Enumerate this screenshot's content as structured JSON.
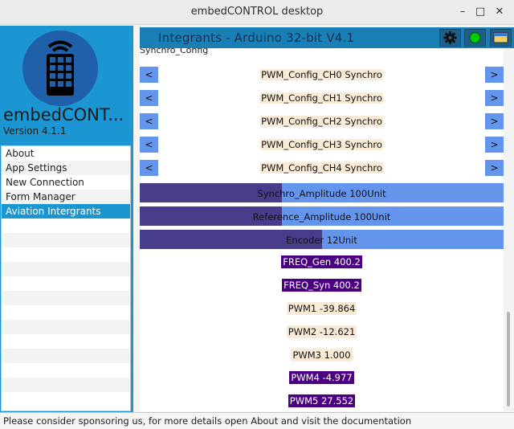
{
  "window": {
    "title": "embedCONTROL desktop",
    "minimize_glyph": "–",
    "maximize_glyph": "□",
    "close_glyph": "✕"
  },
  "sidebar": {
    "app_name": "embedCONTROL desktop",
    "version": "Version 4.1.1",
    "items": [
      {
        "label": "About"
      },
      {
        "label": "App Settings"
      },
      {
        "label": "New Connection"
      },
      {
        "label": "Form Manager"
      },
      {
        "label": "Aviation Intergrants"
      }
    ],
    "active_index": 4
  },
  "main": {
    "title": "Integrants - Arduino 32-bit V4.1",
    "header_icons": [
      "gear-icon",
      "connection-status-icon",
      "window-layout-icon"
    ],
    "connection_status_color": "#00cc00",
    "section_label": "Synchro_Config",
    "sync_rows": [
      {
        "left": "<",
        "label": "PWM_Config_CH0 Synchro",
        "right": ">"
      },
      {
        "left": "<",
        "label": "PWM_Config_CH1 Synchro",
        "right": ">"
      },
      {
        "left": "<",
        "label": "PWM_Config_CH2 Synchro",
        "right": ">"
      },
      {
        "left": "<",
        "label": "PWM_Config_CH3 Synchro",
        "right": ">"
      },
      {
        "left": "<",
        "label": "PWM_Config_CH4 Synchro",
        "right": ">"
      }
    ],
    "bars": [
      {
        "label": "Synchro_Amplitude 100Unit",
        "fill_fraction": 0.39
      },
      {
        "label": "Reference_Amplitude 100Unit",
        "fill_fraction": 0.39
      },
      {
        "label": "Encoder 12Unit",
        "fill_fraction": 0.5
      }
    ],
    "values": [
      {
        "label": "FREQ_Gen 400.2",
        "style": "purple"
      },
      {
        "label": "FREQ_Syn 400.2",
        "style": "purple"
      },
      {
        "label": "PWM1 -39.864",
        "style": "plain"
      },
      {
        "label": "PWM2 -12.621",
        "style": "plain"
      },
      {
        "label": "PWM3 1.000",
        "style": "plain"
      },
      {
        "label": "PWM4 -4.977",
        "style": "purple"
      },
      {
        "label": "PWM5 27.552",
        "style": "purple"
      }
    ]
  },
  "status": {
    "message": "Please consider sponsoring us, for more details open About and visit the documentation"
  },
  "colors": {
    "sidebar_blue": "#1c96d2",
    "header_blue": "#1a7fb5",
    "bar_background": "#6495ed",
    "bar_fill": "#483d8b",
    "value_purple": "#4b0082",
    "value_plain": "#faebd7"
  }
}
